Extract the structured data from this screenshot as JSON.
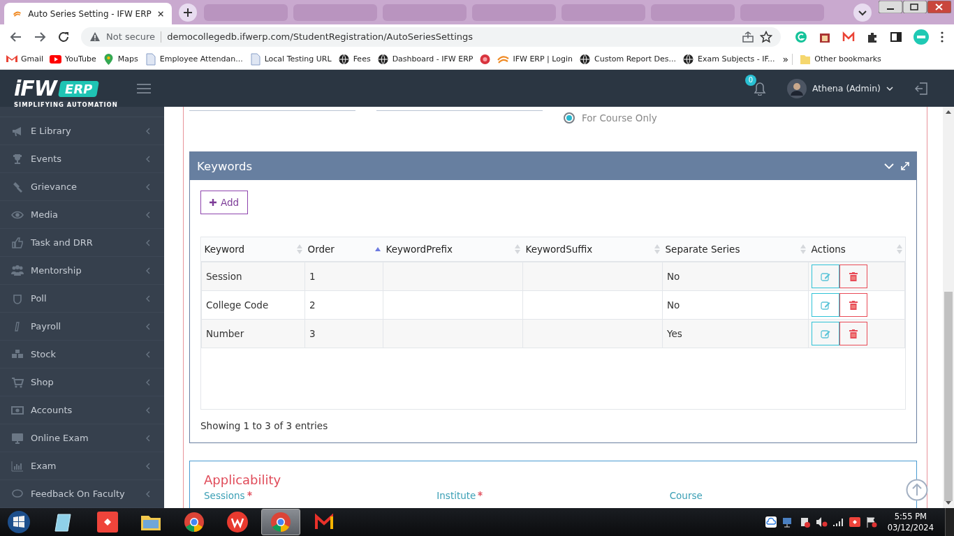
{
  "browser": {
    "tabs": [
      {
        "title": "Auto Series Setting - IFW ERP",
        "selected": true
      },
      {
        "selected": false
      },
      {
        "selected": false
      },
      {
        "selected": false
      },
      {
        "selected": false
      },
      {
        "selected": false
      },
      {
        "selected": false
      },
      {
        "selected": false
      }
    ],
    "address": {
      "security": "Not secure",
      "url": "democollegedb.ifwerp.com/StudentRegistration/AutoSeriesSettings"
    },
    "bookmarks": [
      {
        "label": "Gmail",
        "kind": "gmail"
      },
      {
        "label": "YouTube",
        "kind": "youtube"
      },
      {
        "label": "Maps",
        "kind": "maps"
      },
      {
        "label": "Employee Attendan...",
        "kind": "page"
      },
      {
        "label": "Local Testing URL",
        "kind": "page"
      },
      {
        "label": "Fees",
        "kind": "globe"
      },
      {
        "label": "Dashboard - IFW ERP",
        "kind": "globe"
      },
      {
        "kind": "dot"
      },
      {
        "label": "IFW ERP | Login",
        "kind": "ifw"
      },
      {
        "label": "Custom Report Des...",
        "kind": "globe"
      },
      {
        "label": "Exam Subjects - IF...",
        "kind": "globe"
      }
    ],
    "more_bookmarks": "»",
    "other_bookmarks": "Other bookmarks"
  },
  "header": {
    "logo": {
      "brand": "iFW",
      "badge": "ERP",
      "tagline": "SIMPLIFYING AUTOMATION"
    },
    "notification_count": "0",
    "user": "Athena (Admin)"
  },
  "sidebar": {
    "items": [
      {
        "label": "E Library"
      },
      {
        "label": "Events"
      },
      {
        "label": "Grievance"
      },
      {
        "label": "Media"
      },
      {
        "label": "Task and DRR"
      },
      {
        "label": "Mentorship"
      },
      {
        "label": "Poll"
      },
      {
        "label": "Payroll"
      },
      {
        "label": "Stock"
      },
      {
        "label": "Shop"
      },
      {
        "label": "Accounts"
      },
      {
        "label": "Online Exam"
      },
      {
        "label": "Exam"
      },
      {
        "label": "Feedback On Faculty"
      }
    ]
  },
  "scope_option": {
    "label": "For Course Only",
    "selected": true
  },
  "keywords_panel": {
    "title": "Keywords",
    "add_button": "Add",
    "table": {
      "columns": [
        {
          "label": "Keyword",
          "sorted_ascending": false
        },
        {
          "label": "Order",
          "sorted_ascending": true
        },
        {
          "label": "KeywordPrefix",
          "sorted_ascending": false
        },
        {
          "label": "KeywordSuffix",
          "sorted_ascending": false
        },
        {
          "label": "Separate Series",
          "sorted_ascending": false
        },
        {
          "label": "Actions",
          "sorted_ascending": false
        }
      ],
      "rows": [
        {
          "keyword": "Session",
          "order": "1",
          "separate_series": "No"
        },
        {
          "keyword": "College Code",
          "order": "2",
          "separate_series": "No"
        },
        {
          "keyword": "Number",
          "order": "3",
          "separate_series": "Yes"
        }
      ]
    },
    "info": "Showing 1 to 3 of 3 entries"
  },
  "applicability": {
    "title": "Applicability",
    "fields": [
      {
        "label": "Sessions",
        "required": true
      },
      {
        "label": "Institute",
        "required": true
      },
      {
        "label": "Course",
        "required": false
      }
    ]
  },
  "taskbar": {
    "apps": [
      {
        "kind": "notes",
        "selected": false
      },
      {
        "kind": "remote",
        "selected": false
      },
      {
        "kind": "folder",
        "selected": false
      },
      {
        "kind": "chrome",
        "selected": false
      },
      {
        "kind": "wps",
        "selected": false
      },
      {
        "kind": "chrome",
        "selected": true
      },
      {
        "kind": "mail",
        "selected": false
      }
    ],
    "time": "5:55 PM",
    "date": "03/12/2024"
  }
}
